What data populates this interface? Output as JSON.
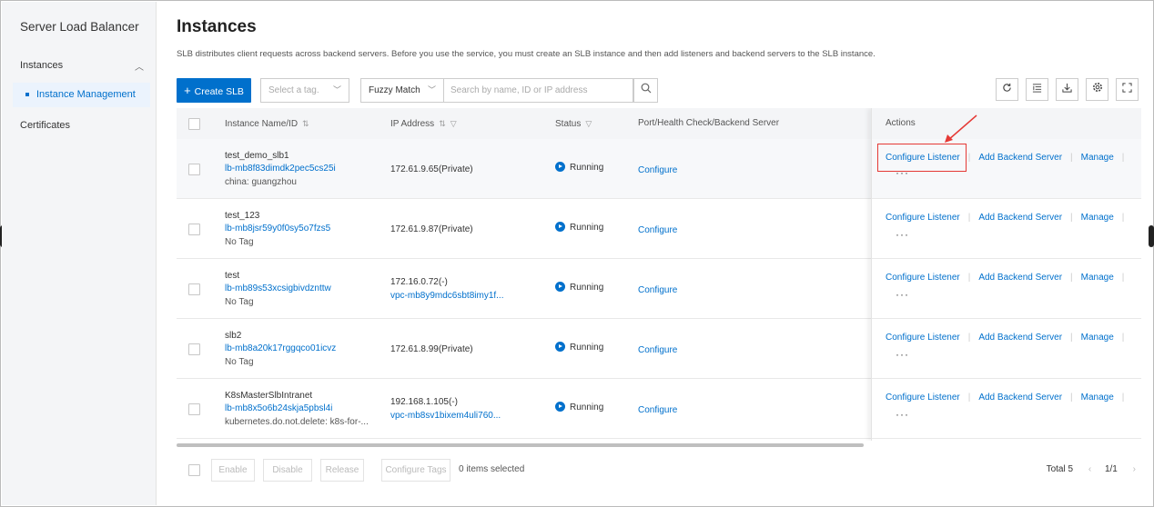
{
  "sidebar": {
    "title": "Server Load Balancer",
    "group": "Instances",
    "active_item": "Instance Management",
    "other_item": "Certificates"
  },
  "header": {
    "title": "Instances",
    "description": "SLB distributes client requests across backend servers. Before you use the service, you must create an SLB instance and then add listeners and backend servers to the SLB instance."
  },
  "toolbar": {
    "create_label": "Create SLB",
    "tag_placeholder": "Select a tag.",
    "match_mode": "Fuzzy Match",
    "search_placeholder": "Search by name, ID or IP address"
  },
  "table": {
    "columns": [
      "Instance Name/ID",
      "IP Address",
      "Status",
      "Port/Health Check/Backend Server",
      "Actions"
    ],
    "rows": [
      {
        "name": "test_demo_slb1",
        "id": "lb-mb8f83dimdk2pec5cs25i",
        "tag": "china: guangzhou",
        "ip": "172.61.9.65(Private)",
        "vpc": "",
        "status": "Running",
        "port": "Configure"
      },
      {
        "name": "test_123",
        "id": "lb-mb8jsr59y0f0sy5o7fzs5",
        "tag": "No Tag",
        "ip": "172.61.9.87(Private)",
        "vpc": "",
        "status": "Running",
        "port": "Configure"
      },
      {
        "name": "test",
        "id": "lb-mb89s53xcsigbivdznttw",
        "tag": "No Tag",
        "ip": "172.16.0.72(-)",
        "vpc": "vpc-mb8y9mdc6sbt8imy1f...",
        "status": "Running",
        "port": "Configure"
      },
      {
        "name": "slb2",
        "id": "lb-mb8a20k17rggqco01icvz",
        "tag": "No Tag",
        "ip": "172.61.8.99(Private)",
        "vpc": "",
        "status": "Running",
        "port": "Configure"
      },
      {
        "name": "K8sMasterSlbIntranet",
        "id": "lb-mb8x5o6b24skja5pbsl4i",
        "tag": "kubernetes.do.not.delete: k8s-for-...",
        "ip": "192.168.1.105(-)",
        "vpc": "vpc-mb8sv1bixem4uli760...",
        "status": "Running",
        "port": "Configure"
      }
    ],
    "actions": {
      "configure_listener": "Configure Listener",
      "add_backend": "Add Backend Server",
      "manage": "Manage",
      "more": "···"
    }
  },
  "footer": {
    "enable": "Enable",
    "disable": "Disable",
    "release": "Release",
    "configure_tags": "Configure Tags",
    "selected": "0 items selected",
    "total": "Total 5",
    "page": "1/1"
  },
  "colors": {
    "accent": "#0070cc",
    "highlight": "#e53935"
  }
}
